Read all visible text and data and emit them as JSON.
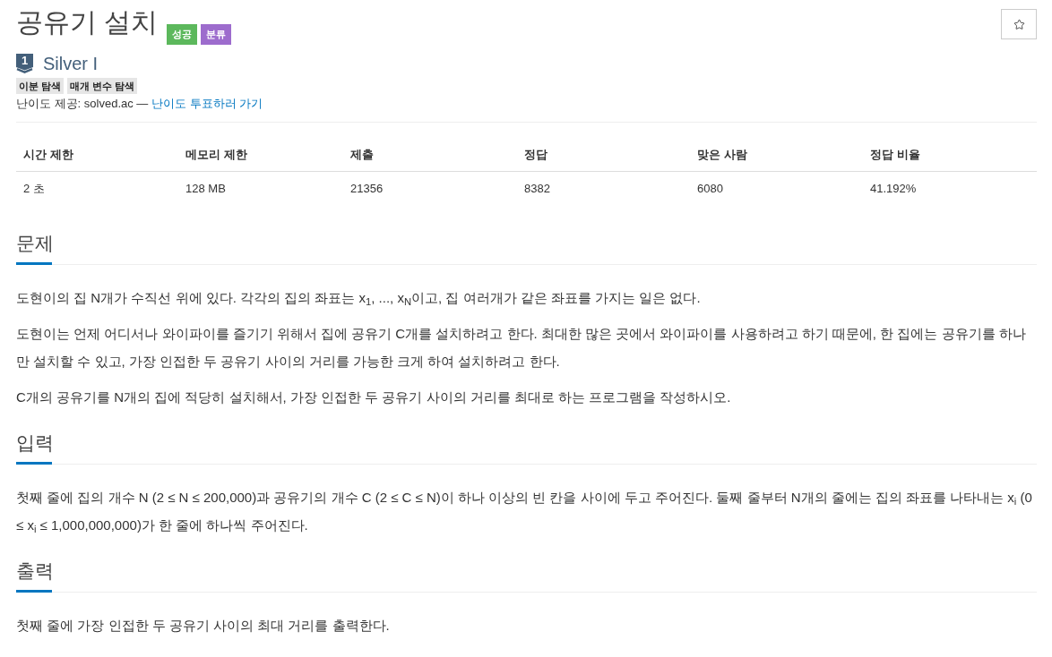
{
  "title": "공유기 설치",
  "badges": [
    {
      "label": "성공",
      "kind": "success"
    },
    {
      "label": "분류",
      "kind": "category"
    }
  ],
  "tier": {
    "number": "1",
    "name": "Silver I"
  },
  "tags": [
    "이분 탐색",
    "매개 변수 탐색"
  ],
  "difficulty_credit": {
    "text": "난이도 제공: solved.ac —",
    "link": "난이도 투표하러 가기"
  },
  "stats": {
    "columns": [
      "시간 제한",
      "메모리 제한",
      "제출",
      "정답",
      "맞은 사람",
      "정답 비율"
    ],
    "rows": [
      [
        "2 초",
        "128 MB",
        "21356",
        "8382",
        "6080",
        "41.192%"
      ]
    ]
  },
  "sections": [
    {
      "heading": "문제",
      "paragraphs": [
        "도현이의 집 N개가 수직선 위에 있다. 각각의 집의 좌표는 x$_{1}$, ..., x$_{N}$이고, 집 여러개가 같은 좌표를 가지는 일은 없다.",
        "도현이는 언제 어디서나 와이파이를 즐기기 위해서 집에 공유기 C개를 설치하려고 한다. 최대한 많은 곳에서 와이파이를 사용하려고 하기 때문에, 한 집에는 공유기를 하나만 설치할 수 있고, 가장 인접한 두 공유기 사이의 거리를 가능한 크게 하여 설치하려고 한다.",
        "C개의 공유기를 N개의 집에 적당히 설치해서, 가장 인접한 두 공유기 사이의 거리를 최대로 하는 프로그램을 작성하시오."
      ]
    },
    {
      "heading": "입력",
      "paragraphs": [
        "첫째 줄에 집의 개수 N (2 ≤ N ≤ 200,000)과 공유기의 개수 C (2 ≤ C ≤ N)이 하나 이상의 빈 칸을 사이에 두고 주어진다. 둘째 줄부터 N개의 줄에는 집의 좌표를 나타내는 x$_{i}$ (0 ≤ x$_{i}$ ≤ 1,000,000,000)가 한 줄에 하나씩 주어진다."
      ]
    },
    {
      "heading": "출력",
      "paragraphs": [
        "첫째 줄에 가장 인접한 두 공유기 사이의 최대 거리를 출력한다."
      ]
    }
  ]
}
